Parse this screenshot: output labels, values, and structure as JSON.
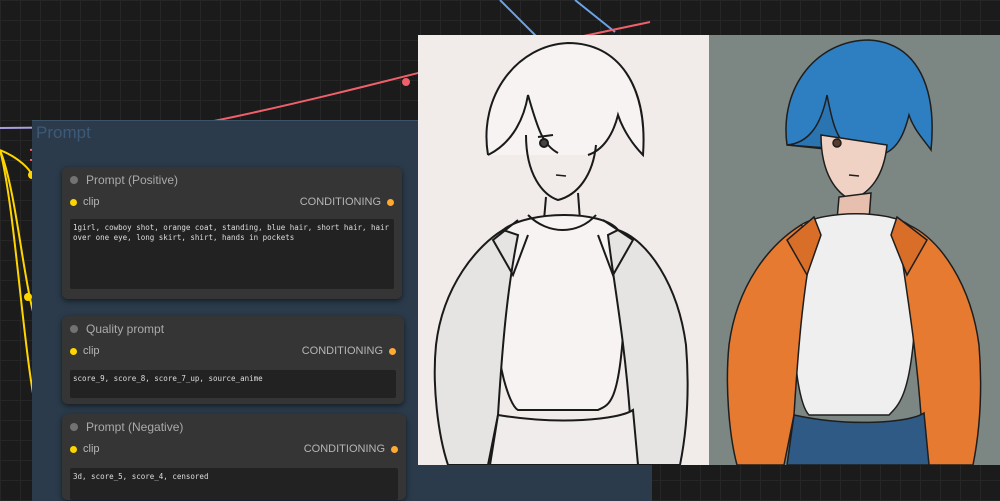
{
  "group": {
    "title": "Prompt"
  },
  "nodes": [
    {
      "title": "Prompt (Positive)",
      "input_label": "clip",
      "output_label": "CONDITIONING",
      "text": "1girl, cowboy shot, orange coat, standing, blue hair, short hair, hair over one eye, long skirt, shirt, hands in pockets"
    },
    {
      "title": "Quality prompt",
      "input_label": "clip",
      "output_label": "CONDITIONING",
      "text": "score_9, score_8, score_7_up, source_anime"
    },
    {
      "title": "Prompt (Negative)",
      "input_label": "clip",
      "output_label": "CONDITIONING",
      "text": "3d, score_5, score_4, censored"
    }
  ],
  "images": {
    "left": "sketch-lineart",
    "right": "colored-illustration"
  },
  "colors": {
    "clip_wire": "#ffd500",
    "conditioning_wire": "#f0606a",
    "model_wire": "#6aa3e8",
    "group_bg": "#2b3b4b"
  }
}
